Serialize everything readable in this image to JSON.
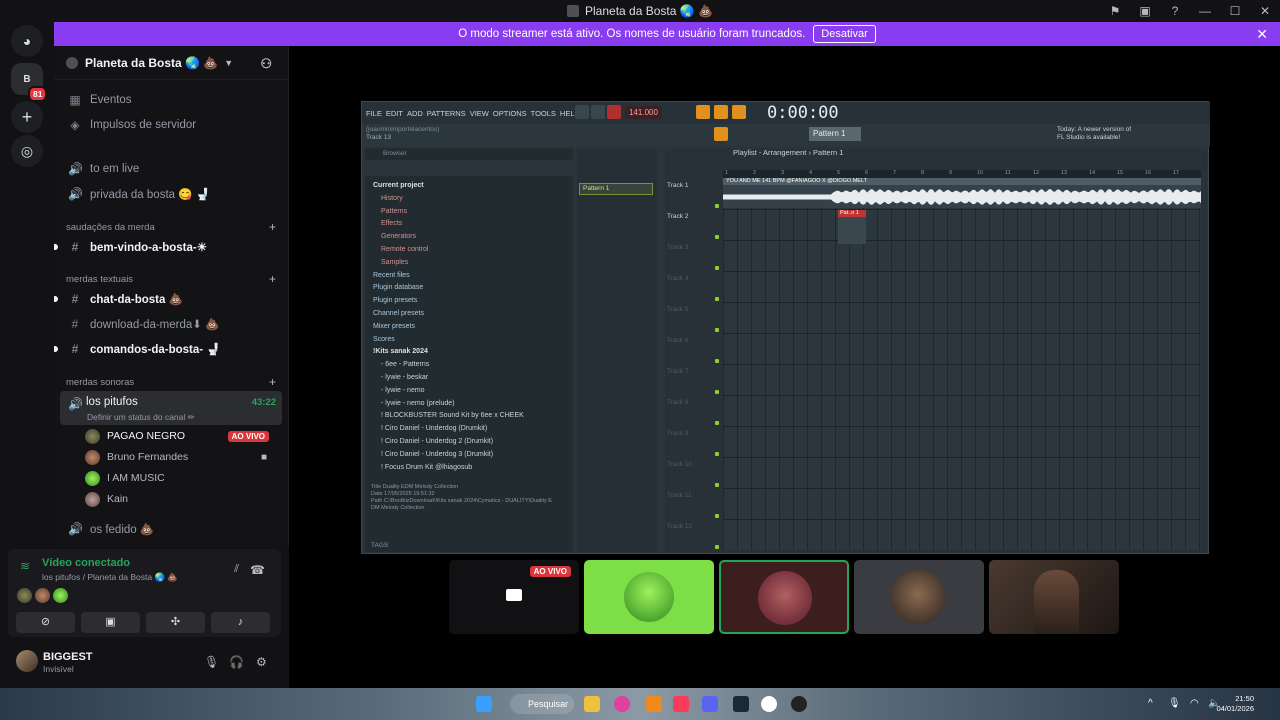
{
  "window": {
    "title": "Planeta da Bosta 🌏 💩"
  },
  "banner": {
    "text": "O modo streamer está ativo. Os nomes de usuário foram truncados.",
    "button": "Desativar"
  },
  "rail": {
    "server_initial": "B",
    "mention_badge": "81"
  },
  "server": {
    "name": "Planeta da Bosta 🌏 💩"
  },
  "sidebar": {
    "events": "Eventos",
    "boosts": "Impulsos de servidor",
    "channels_top": [
      {
        "name": "to em live"
      },
      {
        "name": "privada da bosta 😋 🚽"
      }
    ],
    "cat1": "saudações da merda",
    "welcome": "bem-vindo-a-bosta-☀",
    "cat2": "merdas textuais",
    "text_channels": [
      {
        "name": "chat-da-bosta 💩"
      },
      {
        "name": "download-da-merda⬇ 💩"
      },
      {
        "name": "comandos-da-bosta- 🚽"
      }
    ],
    "cat3": "merdas sonoras",
    "voice_channel": {
      "name": "los pitufos",
      "time": "43:22",
      "status": "Definir um status do canal ✏"
    },
    "voice_users": [
      {
        "name": "PAGAO NEGRO",
        "badge": "AO VIVO"
      },
      {
        "name": "Bruno Fernandes"
      },
      {
        "name": "I AM MUSIC"
      },
      {
        "name": "Kain"
      }
    ],
    "other_voice": "os fedido 💩"
  },
  "voice_panel": {
    "title": "Vídeo conectado",
    "subtitle": "los pitufos / Planeta da Bosta 🌏 💩"
  },
  "user": {
    "name": "BIGGEST",
    "status": "Invisível"
  },
  "fl": {
    "menu": [
      "FILE",
      "EDIT",
      "ADD",
      "PATTERNS",
      "VIEW",
      "OPTIONS",
      "TOOLS",
      "HELP"
    ],
    "tempo": "141.000",
    "time": "0:00:00",
    "hint": "(joaommimportelacentos)",
    "hint2": "Track 13",
    "pattern": "Pattern 1",
    "news1": "Today: A newer version of",
    "news2": "FL Studio is available!",
    "browser_title": "Browser",
    "browser_items": [
      {
        "label": "Current project",
        "kind": "grp"
      },
      {
        "label": "History",
        "kind": "sub"
      },
      {
        "label": "Patterns",
        "kind": "sub"
      },
      {
        "label": "Effects",
        "kind": "sub"
      },
      {
        "label": "Generators",
        "kind": "sub"
      },
      {
        "label": "Remote control",
        "kind": "sub"
      },
      {
        "label": "Samples",
        "kind": "sub"
      },
      {
        "label": "Recent files",
        "kind": "item"
      },
      {
        "label": "Plugin database",
        "kind": "item"
      },
      {
        "label": "Plugin presets",
        "kind": "item"
      },
      {
        "label": "Channel presets",
        "kind": "item"
      },
      {
        "label": "Mixer presets",
        "kind": "item"
      },
      {
        "label": "Scores",
        "kind": "item"
      },
      {
        "label": "!Kits sanak 2024",
        "kind": "grp"
      },
      {
        "label": "- 6ee - Patterns",
        "kind": "folder"
      },
      {
        "label": "- lywie - beskar",
        "kind": "folder"
      },
      {
        "label": "- lywie - nemo",
        "kind": "folder"
      },
      {
        "label": "- lywie - nemo (prelude)",
        "kind": "folder"
      },
      {
        "label": "! BLOCKBUSTER Sound Kit by 6ee x CHEEK",
        "kind": "folder"
      },
      {
        "label": "! Ciro Daniel - Underdog (Drumkit)",
        "kind": "folder"
      },
      {
        "label": "! Ciro Daniel - Underdog 2 (Drumkit)",
        "kind": "folder"
      },
      {
        "label": "! Ciro Daniel - Underdog 3 (Drumkit)",
        "kind": "folder"
      },
      {
        "label": "! Focus Drum Kit @lhiagosub",
        "kind": "folder"
      }
    ],
    "meta": {
      "title_label": "Title",
      "title": "Duality EDM Melody Collection",
      "date_label": "Date",
      "date": "17/05/2025 19:51:32",
      "path_label": "Path",
      "path": "C:\\BrodbizDownload\\!Kits sanak 2024\\Cymatics - DUALITY\\Duality E",
      "path2": "DM Melody Collection"
    },
    "tags": "TAGS",
    "pattern_item": "Pattern 1",
    "playlist_title": "Playlist - Arrangement › Pattern 1",
    "ruler": [
      "1",
      "2",
      "3",
      "4",
      "5",
      "6",
      "7",
      "8",
      "9",
      "10",
      "11",
      "12",
      "13",
      "14",
      "15",
      "16",
      "17"
    ],
    "tracks": [
      "Track 1",
      "Track 2",
      "Track 3",
      "Track 4",
      "Track 5",
      "Track 6",
      "Track 7",
      "Track 8",
      "Track 9",
      "Track 10",
      "Track 11",
      "Track 12"
    ],
    "audio_clip": "YOU AND ME 141 BPM @FANIAGOO X @DIOGO.MELT",
    "pat_clip": "Pat..n 1"
  },
  "tiles": {
    "live": "AO VIVO"
  },
  "taskbar": {
    "search": "Pesquisar",
    "time": "21:50",
    "date": "04/01/2026"
  }
}
